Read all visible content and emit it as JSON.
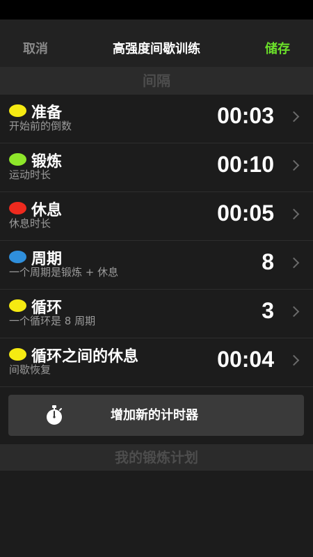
{
  "nav": {
    "cancel_label": "取消",
    "title": "高强度间歇训练",
    "save_label": "储存"
  },
  "interval_section": {
    "title": "间隔"
  },
  "rows": [
    {
      "title": "准备",
      "subtitle": "开始前的倒数",
      "value": "00:03",
      "color": "#f5ea12"
    },
    {
      "title": "锻炼",
      "subtitle": "运动时长",
      "value": "00:10",
      "color": "#8ee62a"
    },
    {
      "title": "休息",
      "subtitle": "休息时长",
      "value": "00:05",
      "color": "#ee2a1e"
    },
    {
      "title": "周期",
      "subtitle": "一个周期是锻炼 + 休息",
      "value": "8",
      "color": "#2f8fdc"
    },
    {
      "title": "循环",
      "subtitle": "一个循环是 8 周期",
      "value": "3",
      "color": "#f5ea12"
    },
    {
      "title": "循环之间的休息",
      "subtitle": "间歇恢复",
      "value": "00:04",
      "color": "#f5ea12"
    }
  ],
  "add_timer": {
    "label": "增加新的计时器",
    "icon": "stopwatch-icon"
  },
  "plans_section": {
    "title": "我的锻炼计划"
  }
}
